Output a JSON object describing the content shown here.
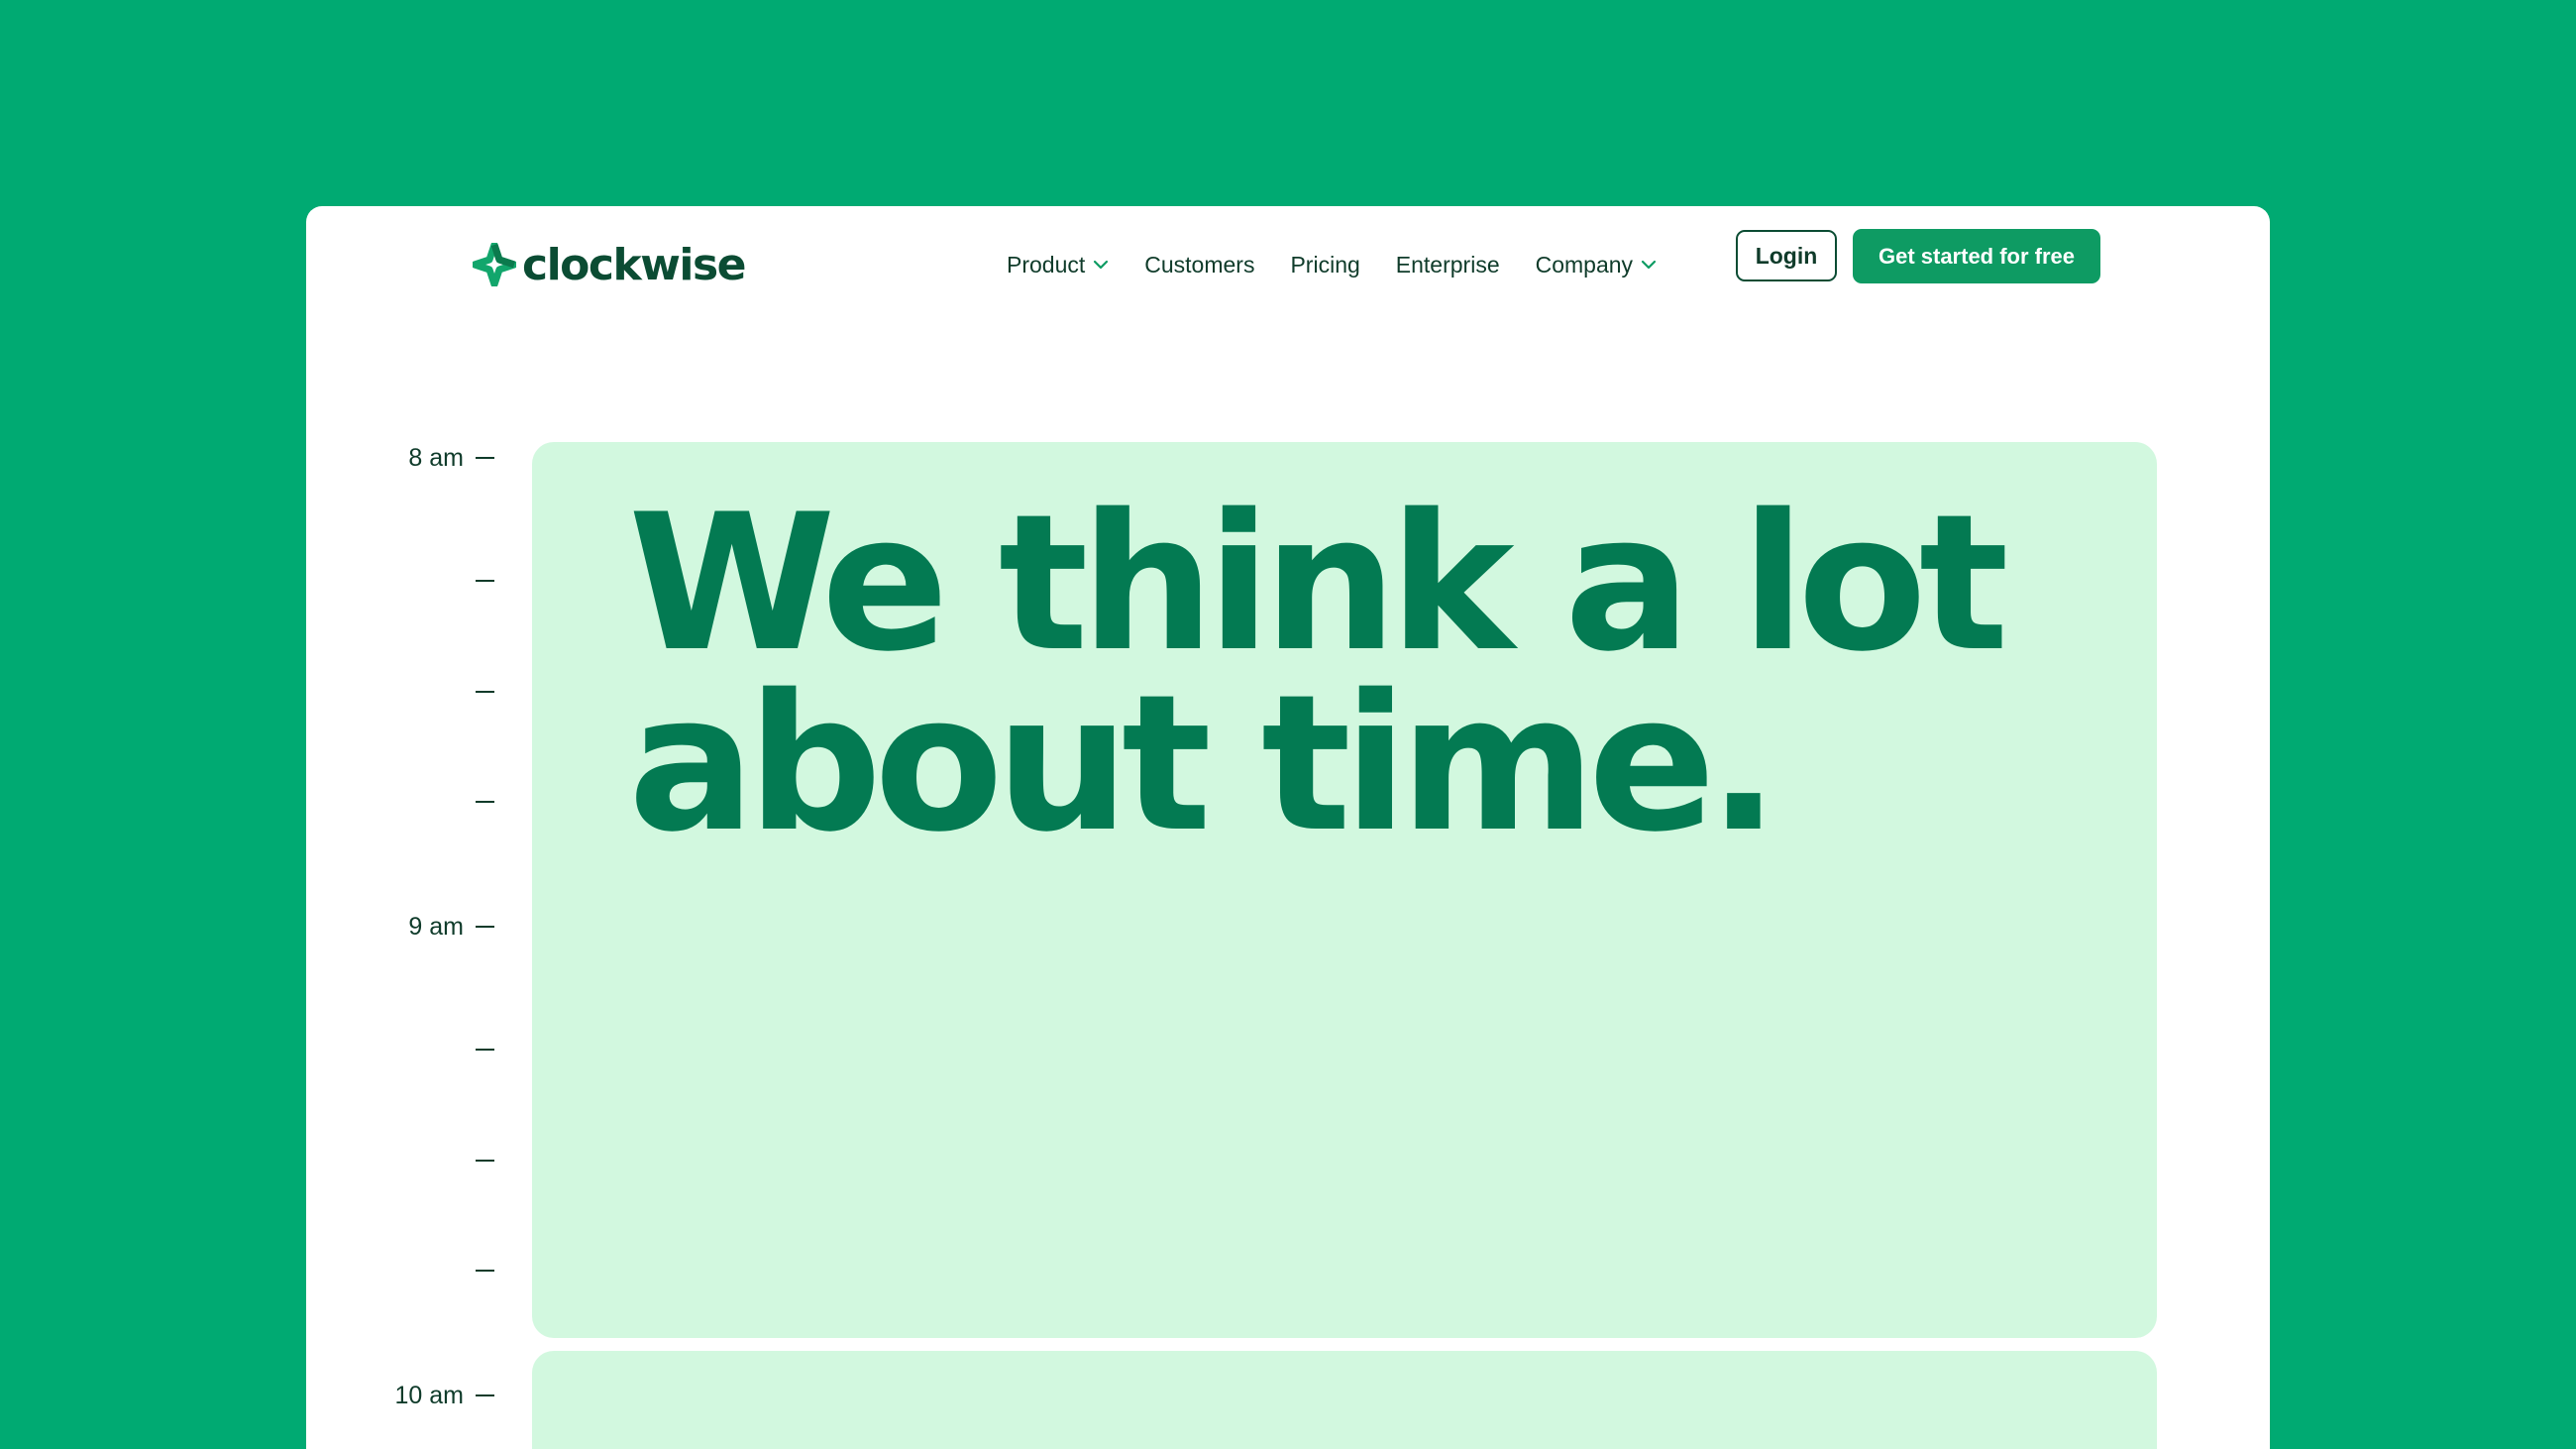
{
  "brand": {
    "name": "clockwise",
    "logo_icon": "clockwise-sparkle-icon",
    "primary_color": "#00aa72",
    "dark_color": "#0b4c33",
    "accent_color": "#0e9b63",
    "event_color": "#d2f8df",
    "headline_color": "#037a52"
  },
  "nav": {
    "items": [
      {
        "label": "Product",
        "has_dropdown": true
      },
      {
        "label": "Customers",
        "has_dropdown": false
      },
      {
        "label": "Pricing",
        "has_dropdown": false
      },
      {
        "label": "Enterprise",
        "has_dropdown": false
      },
      {
        "label": "Company",
        "has_dropdown": true
      }
    ],
    "login_label": "Login",
    "cta_label": "Get started for free"
  },
  "time_axis": {
    "labels": [
      "8 am",
      "9 am",
      "10 am"
    ]
  },
  "hero": {
    "headline": "We think a lot about time."
  }
}
